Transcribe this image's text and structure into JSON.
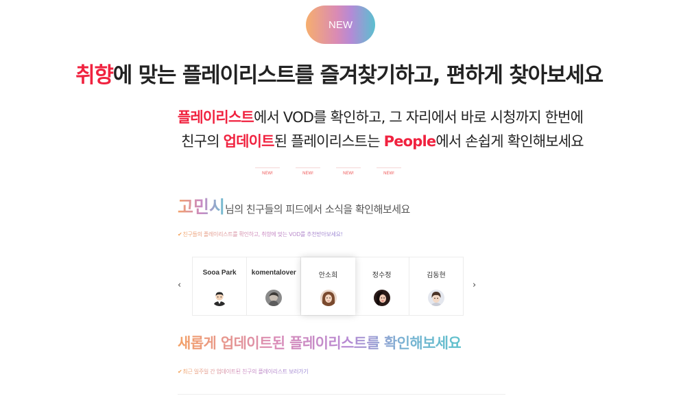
{
  "badge": {
    "label": "NEW"
  },
  "headline": {
    "highlight": "취향",
    "rest": "에 맞는 플레이리스트를 즐겨찾기하고, 편하게 찾아보세요"
  },
  "subline1": {
    "highlight": "플레이리스트",
    "rest": "에서 VOD를 확인하고, 그 자리에서 바로 시청까지 한번에"
  },
  "subline2": {
    "part1": "친구의 ",
    "highlight1": "업데이트",
    "part2": "된 플레이리스트는 ",
    "highlight2": "People",
    "part3": "에서 손쉽게 확인해보세요"
  },
  "new_badges": [
    "NEW!",
    "NEW!",
    "NEW!",
    "NEW!"
  ],
  "panel": {
    "user_name": "고민시",
    "greeting": "님의 친구들의 피드에서 소식을 확인해보세요",
    "hint1": "친구들의 플레이리스트를 확인하고, 취향에 맞는 VOD를 추천받아보세요!",
    "prev_arrow": "‹",
    "next_arrow": "›",
    "friends": [
      {
        "name": "Sooa Park",
        "avatar": "male-avatar-icon"
      },
      {
        "name": "komentalover",
        "avatar": "photo-avatar-icon"
      },
      {
        "name": "안소희",
        "avatar": "photo-avatar-icon"
      },
      {
        "name": "정수정",
        "avatar": "photo-avatar-icon"
      },
      {
        "name": "김동현",
        "avatar": "photo-avatar-icon"
      }
    ],
    "active_friend_index": 2,
    "updated_title": "새롭게 업데이트된 플레이리스트를 확인해보세요",
    "hint2": "최근 일주일 간 업데이트된 친구의 플레이리스트 보러가기",
    "check_mark": "✔"
  },
  "colors": {
    "accent_red": "#f0223f",
    "gradient": [
      "#f4a26b",
      "#c98ac4",
      "#5fc1cc"
    ]
  }
}
